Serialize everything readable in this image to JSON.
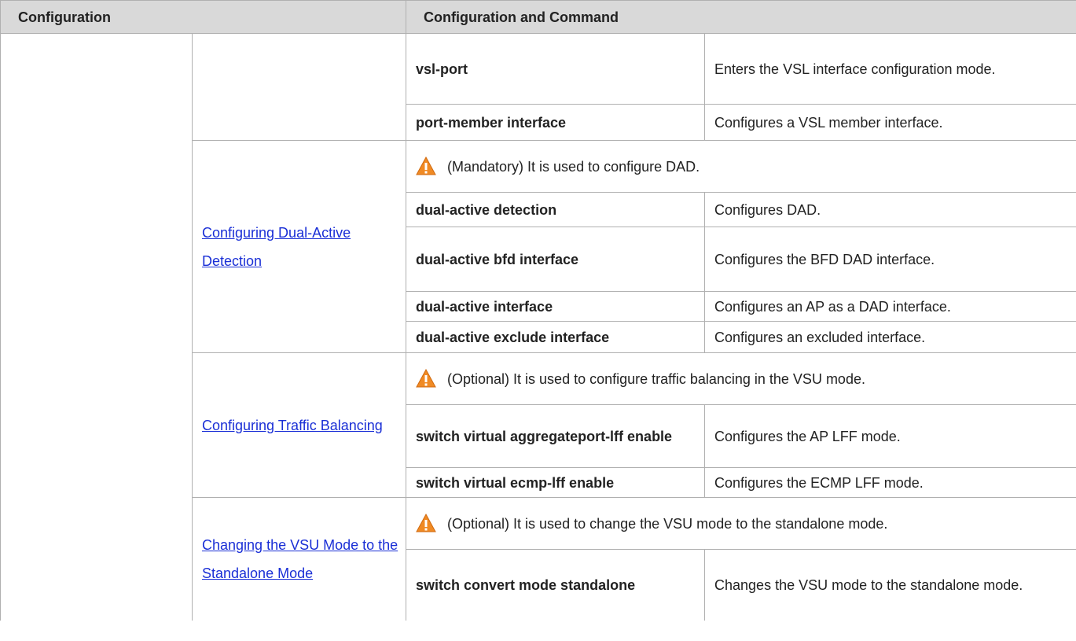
{
  "header": {
    "col1": "Configuration",
    "col2": "Configuration and Command"
  },
  "vsl": {
    "rows": [
      {
        "cmd": "vsl-port",
        "desc": "Enters the VSL interface configuration mode."
      },
      {
        "cmd": "port-member interface",
        "desc": "Configures a VSL member interface."
      }
    ]
  },
  "dad": {
    "link": "Configuring Dual-Active Detection",
    "note": "(Mandatory) It is used to configure DAD.",
    "rows": [
      {
        "cmd": "dual-active detection",
        "desc": "Configures DAD."
      },
      {
        "cmd": "dual-active bfd interface",
        "desc": "Configures the BFD DAD interface."
      },
      {
        "cmd": "dual-active interface",
        "desc": "Configures an AP as a DAD interface."
      },
      {
        "cmd": "dual-active exclude interface",
        "desc": "Configures an excluded interface."
      }
    ]
  },
  "traffic": {
    "link": "Configuring Traffic Balancing",
    "note": "(Optional) It is used to configure traffic balancing in the VSU mode.",
    "rows": [
      {
        "cmd": "switch virtual aggregateport-lff enable",
        "desc": "Configures the AP LFF mode."
      },
      {
        "cmd": "switch virtual ecmp-lff enable",
        "desc": "Configures the ECMP LFF mode."
      }
    ]
  },
  "standalone": {
    "link": "Changing the VSU Mode to the Standalone Mode",
    "note": "(Optional) It is used to change the VSU mode to the standalone mode.",
    "rows": [
      {
        "cmd": "switch convert mode standalone",
        "desc": "Changes the VSU mode to the standalone mode."
      }
    ]
  },
  "icons": {
    "warning": "warning-triangle-icon",
    "warning_color": "#f08a24"
  },
  "colors": {
    "header_bg": "#d9d9d9",
    "link": "#1a2fd6"
  }
}
